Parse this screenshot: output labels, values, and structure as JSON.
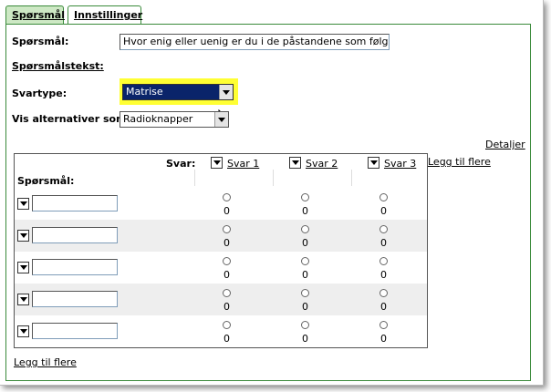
{
  "tabs": [
    {
      "label": "Spørsmål",
      "active": true
    },
    {
      "label": "Innstillinger",
      "active": false
    }
  ],
  "form": {
    "question_label": "Spørsmål:",
    "question_value": "Hvor enig eller uenig er du i de påstandene som følger ned",
    "question_text_label": "Spørsmålstekst:",
    "answer_type_label": "Svartype:",
    "answer_type_value": "Matrise",
    "show_alternatives_label": "Vis alternativer som",
    "show_alternatives_value": "Radioknapper"
  },
  "links": {
    "details": "Detaljer",
    "add_more_columns": "Legg til flere",
    "add_more_rows": "Legg til flere"
  },
  "matrix": {
    "svar_label": "Svar:",
    "question_col_label": "Spørsmål:",
    "columns": [
      "Svar 1",
      "Svar 2",
      "Svar 3"
    ],
    "rows": [
      {
        "cells": [
          "0",
          "0",
          "0"
        ]
      },
      {
        "cells": [
          "0",
          "0",
          "0"
        ]
      },
      {
        "cells": [
          "0",
          "0",
          "0"
        ]
      },
      {
        "cells": [
          "0",
          "0",
          "0"
        ]
      },
      {
        "cells": [
          "0",
          "0",
          "0"
        ]
      }
    ]
  },
  "colors": {
    "tab_border": "#3a8a3a",
    "tab_active_bg": "#cde8c4",
    "highlight": "#ffff33",
    "select_bg": "#0a246a"
  }
}
